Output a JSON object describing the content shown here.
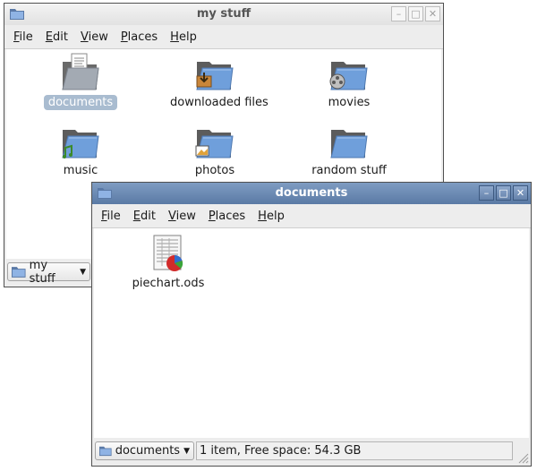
{
  "colors": {
    "folder_blue": "#6f9fdb",
    "folder_dark": "#5c5c5c",
    "selection": "#a9bcd0",
    "active_title": "#6b88b2"
  },
  "back_window": {
    "title": "my stuff",
    "menu": [
      {
        "mnemonic": "F",
        "rest": "ile"
      },
      {
        "mnemonic": "E",
        "rest": "dit"
      },
      {
        "mnemonic": "V",
        "rest": "iew"
      },
      {
        "mnemonic": "P",
        "rest": "laces"
      },
      {
        "mnemonic": "H",
        "rest": "elp"
      }
    ],
    "items": [
      {
        "label": "documents",
        "icon": "folder-documents-icon",
        "selected": true
      },
      {
        "label": "downloaded files",
        "icon": "folder-downloads-icon"
      },
      {
        "label": "movies",
        "icon": "folder-movies-icon"
      },
      {
        "label": "music",
        "icon": "folder-music-icon"
      },
      {
        "label": "photos",
        "icon": "folder-photos-icon"
      },
      {
        "label": "random stuff",
        "icon": "folder-icon"
      }
    ],
    "location": "my stuff"
  },
  "front_window": {
    "title": "documents",
    "menu": [
      {
        "mnemonic": "F",
        "rest": "ile"
      },
      {
        "mnemonic": "E",
        "rest": "dit"
      },
      {
        "mnemonic": "V",
        "rest": "iew"
      },
      {
        "mnemonic": "P",
        "rest": "laces"
      },
      {
        "mnemonic": "H",
        "rest": "elp"
      }
    ],
    "items": [
      {
        "label": "piechart.ods",
        "icon": "spreadsheet-file-icon"
      }
    ],
    "location": "documents",
    "status": "1 item, Free space: 54.3 GB"
  },
  "window_buttons": {
    "minimize": "–",
    "maximize": "□",
    "close": "✕"
  }
}
